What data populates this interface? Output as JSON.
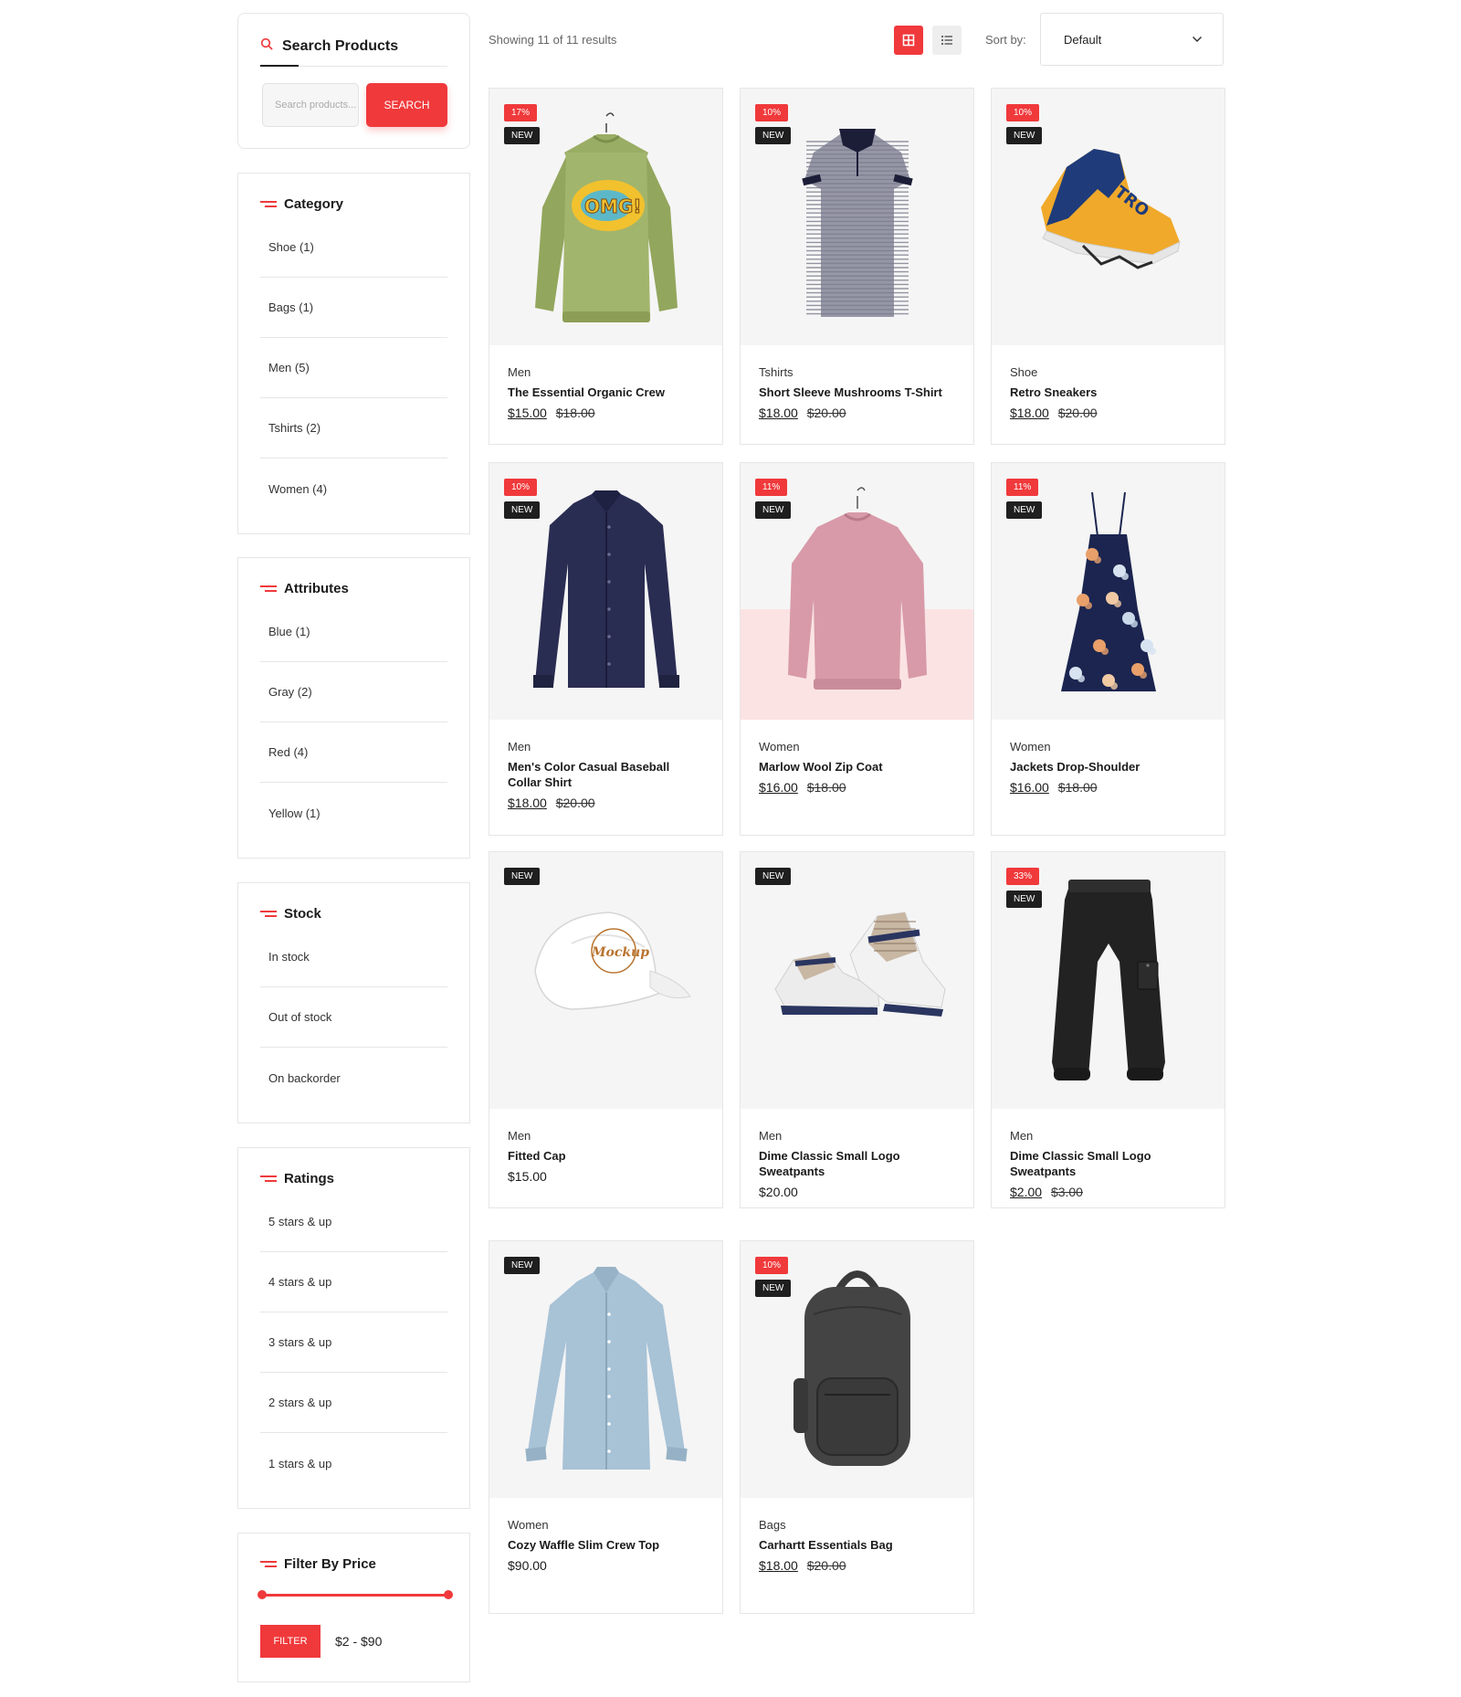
{
  "sidebar": {
    "search": {
      "title": "Search Products",
      "placeholder": "Search products...",
      "button": "SEARCH"
    },
    "category": {
      "title": "Category",
      "items": [
        "Shoe  (1)",
        "Bags  (1)",
        "Men  (5)",
        "Tshirts  (2)",
        "Women  (4)"
      ]
    },
    "attributes": {
      "title": "Attributes",
      "items": [
        "Blue  (1)",
        "Gray  (2)",
        "Red  (4)",
        "Yellow  (1)"
      ]
    },
    "stock": {
      "title": "Stock",
      "items": [
        "In stock",
        "Out of stock",
        "On backorder"
      ]
    },
    "ratings": {
      "title": "Ratings",
      "items": [
        "5 stars & up",
        "4 stars & up",
        "3 stars & up",
        "2 stars & up",
        "1 stars & up"
      ]
    },
    "price": {
      "title": "Filter By Price",
      "button": "FILTER",
      "range": "$2 - $90",
      "min": 2,
      "max": 90
    }
  },
  "toolbar": {
    "results": "Showing 11 of 11 results",
    "sort_label": "Sort by:",
    "sort_value": "Default",
    "active_view": "grid"
  },
  "colors": {
    "accent": "#f0393b",
    "badge_dark": "#1f1f1f"
  },
  "products": [
    {
      "category": "Men",
      "name": "The Essential Organic Crew",
      "price": "$15.00",
      "old_price": "$18.00",
      "discount": "17%",
      "new_label": "NEW",
      "image": "green-sweatshirt"
    },
    {
      "category": "Tshirts",
      "name": "Short Sleeve Mushrooms T-Shirt",
      "price": "$18.00",
      "old_price": "$20.00",
      "discount": "10%",
      "new_label": "NEW",
      "image": "striped-polo"
    },
    {
      "category": "Shoe",
      "name": "Retro Sneakers",
      "price": "$18.00",
      "old_price": "$20.00",
      "discount": "10%",
      "new_label": "NEW",
      "image": "sneaker"
    },
    {
      "category": "Men",
      "name": "Men's Color Casual Baseball Collar Shirt",
      "price": "$18.00",
      "old_price": "$20.00",
      "discount": "10%",
      "new_label": "NEW",
      "image": "navy-shirt"
    },
    {
      "category": "Women",
      "name": "Marlow Wool Zip Coat",
      "price": "$16.00",
      "old_price": "$18.00",
      "discount": "11%",
      "new_label": "NEW",
      "image": "pink-sweatshirt"
    },
    {
      "category": "Women",
      "name": "Jackets Drop-Shoulder",
      "price": "$16.00",
      "old_price": "$18.00",
      "discount": "11%",
      "new_label": "NEW",
      "image": "floral-dress"
    },
    {
      "category": "Men",
      "name": "Fitted Cap",
      "price": "$15.00",
      "old_price": "",
      "discount": "",
      "new_label": "NEW",
      "image": "white-cap"
    },
    {
      "category": "Men",
      "name": "Dime Classic Small Logo Sweatpants",
      "price": "$20.00",
      "old_price": "",
      "discount": "",
      "new_label": "NEW",
      "image": "baby-shoes"
    },
    {
      "category": "Men",
      "name": "Dime Classic Small Logo Sweatpants",
      "price": "$2.00",
      "old_price": "$3.00",
      "discount": "33%",
      "new_label": "NEW",
      "image": "black-pants"
    },
    {
      "category": "Women",
      "name": "Cozy Waffle Slim Crew Top",
      "price": "$90.00",
      "old_price": "",
      "discount": "",
      "new_label": "NEW",
      "image": "blue-blouse"
    },
    {
      "category": "Bags",
      "name": "Carhartt Essentials Bag",
      "price": "$18.00",
      "old_price": "$20.00",
      "discount": "10%",
      "new_label": "NEW",
      "image": "backpack"
    }
  ]
}
